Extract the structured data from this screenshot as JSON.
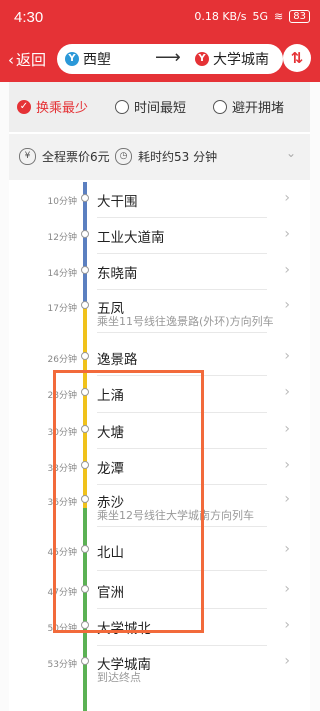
{
  "status_bar": {
    "time": "4:30",
    "net_speed": "0.18 KB/s",
    "signal": "5G",
    "battery": "83"
  },
  "header": {
    "back_label": "返回",
    "from_station": "西塱",
    "to_station": "大学城南",
    "switch_icon": "swap-icon"
  },
  "options": [
    {
      "label": "换乘最少",
      "selected": true
    },
    {
      "label": "时间最短",
      "selected": false
    },
    {
      "label": "避开拥堵",
      "selected": false
    }
  ],
  "info": {
    "fare": "全程票价6元",
    "duration": "耗时约53 分钟"
  },
  "colors": {
    "accent": "#e53236",
    "line_blue": "#5b7fc0",
    "line_yellow": "#f0c21b",
    "line_green": "#5bb154",
    "highlight": "#f26a3b"
  },
  "stops": [
    {
      "time": "10分钟",
      "name": "大干围",
      "sub": ""
    },
    {
      "time": "12分钟",
      "name": "工业大道南",
      "sub": ""
    },
    {
      "time": "14分钟",
      "name": "东晓南",
      "sub": ""
    },
    {
      "time": "17分钟",
      "name": "五凤",
      "sub": "乘坐11号线往逸景路(外环)方向列车"
    },
    {
      "time": "26分钟",
      "name": "逸景路",
      "sub": ""
    },
    {
      "time": "28分钟",
      "name": "上涌",
      "sub": ""
    },
    {
      "time": "30分钟",
      "name": "大塘",
      "sub": ""
    },
    {
      "time": "33分钟",
      "name": "龙潭",
      "sub": ""
    },
    {
      "time": "36分钟",
      "name": "赤沙",
      "sub": "乘坐12号线往大学城南方向列车"
    },
    {
      "time": "45分钟",
      "name": "北山",
      "sub": ""
    },
    {
      "time": "47分钟",
      "name": "官洲",
      "sub": ""
    },
    {
      "time": "50分钟",
      "name": "大学城北",
      "sub": ""
    },
    {
      "time": "53分钟",
      "name": "大学城南",
      "sub": "到达终点"
    }
  ]
}
